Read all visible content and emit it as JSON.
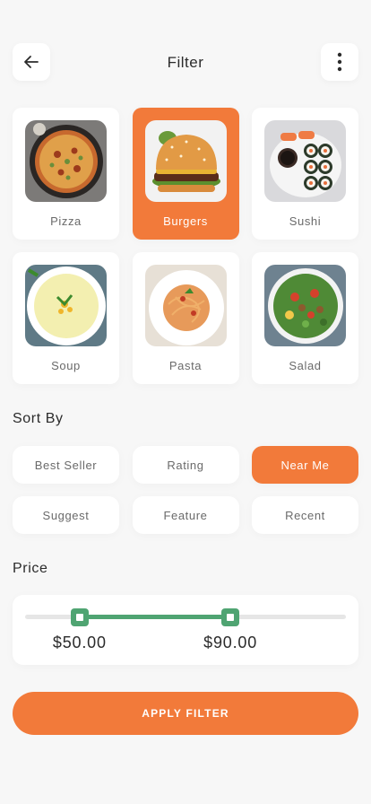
{
  "header": {
    "title": "Filter",
    "back_icon": "arrow-left-icon",
    "more_icon": "more-vertical-icon"
  },
  "categories": [
    {
      "label": "Pizza",
      "active": false
    },
    {
      "label": "Burgers",
      "active": true
    },
    {
      "label": "Sushi",
      "active": false
    },
    {
      "label": "Soup",
      "active": false
    },
    {
      "label": "Pasta",
      "active": false
    },
    {
      "label": "Salad",
      "active": false
    }
  ],
  "sort": {
    "title": "Sort By",
    "options": [
      {
        "label": "Best Seller",
        "active": false
      },
      {
        "label": "Rating",
        "active": false
      },
      {
        "label": "Near Me",
        "active": true
      },
      {
        "label": "Suggest",
        "active": false
      },
      {
        "label": "Feature",
        "active": false
      },
      {
        "label": "Recent",
        "active": false
      }
    ]
  },
  "price": {
    "title": "Price",
    "min_label": "$50.00",
    "max_label": "$90.00",
    "range_start_fraction": 0.17,
    "range_end_fraction": 0.64
  },
  "apply_label": "APPLY FILTER",
  "colors": {
    "accent": "#f27a3a",
    "slider": "#4fa472",
    "background": "#f7f7f7"
  }
}
